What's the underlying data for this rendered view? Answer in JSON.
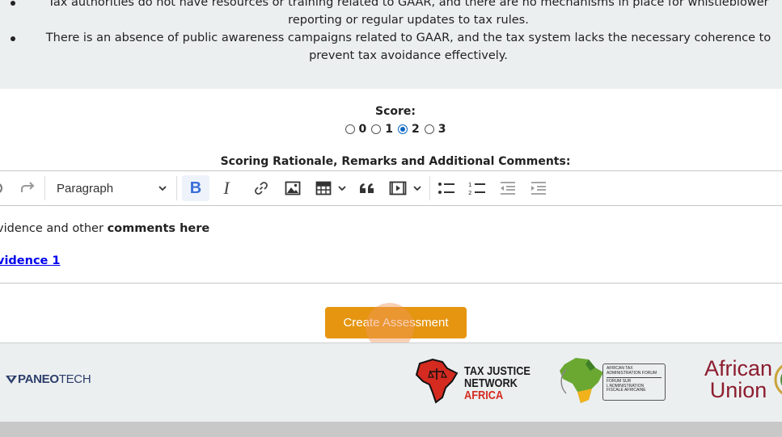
{
  "bullets": [
    "Tax authorities do not have resources or training related to GAAR, and there are no mechanisms in place for whistleblower reporting or regular updates to tax rules.",
    "There is an absence of public awareness campaigns related to GAAR, and the tax system lacks the necessary coherence to prevent tax avoidance effectively."
  ],
  "score": {
    "label": "Score:",
    "options": [
      "0",
      "1",
      "2",
      "3"
    ],
    "selected": "2"
  },
  "rationale": {
    "label": "Scoring Rationale, Remarks and Additional Comments:"
  },
  "toolbar": {
    "block_format": "Paragraph",
    "bold_label": "B",
    "italic_label": "I",
    "icons": [
      "redo-icon",
      "chevron-down-icon",
      "link-icon",
      "image-icon",
      "table-icon",
      "blockquote-icon",
      "media-icon",
      "bulleted-list-icon",
      "numbered-list-icon",
      "outdent-icon",
      "indent-icon"
    ]
  },
  "editor": {
    "line1_prefix": "vidence and other ",
    "line1_bold": "comments here",
    "link_text": "vidence 1"
  },
  "actions": {
    "create_label": "Create Assessment"
  },
  "footer": {
    "paneo_bold": "PANEO",
    "paneo_light": "TECH",
    "tjn_line1": "TAX JUSTICE",
    "tjn_line2": "NETWORK",
    "tjn_line3": "AFRICA",
    "ataf_en_1": "AFRICAN TAX",
    "ataf_en_2": "ADMINISTRATION FORUM",
    "ataf_fr_1": "FORUM SUR",
    "ataf_fr_2": "L'ADMINISTRATION",
    "ataf_fr_3": "FISCALE AFRICAINE",
    "au_line1": "African",
    "au_line2": "Union"
  },
  "colors": {
    "accent_orange": "#e5950f",
    "radio_blue": "#0a66c2",
    "bold_blue": "#3a6fd8",
    "link_blue": "#0000ee",
    "panel_gray": "#eceff0"
  }
}
